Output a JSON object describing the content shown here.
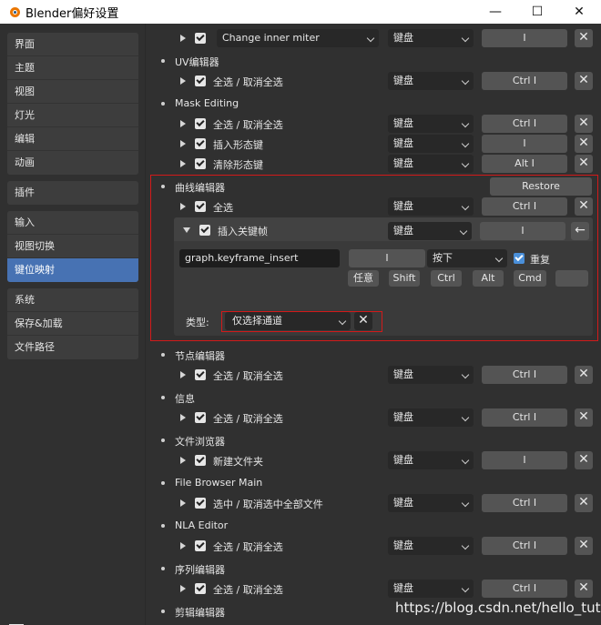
{
  "window": {
    "title": "Blender偏好设置",
    "minimize": "—",
    "maximize": "☐",
    "close": "✕"
  },
  "sidebar": {
    "group1": [
      "界面",
      "主题",
      "视图",
      "灯光",
      "编辑",
      "动画"
    ],
    "group2": [
      "插件"
    ],
    "group3": [
      "输入",
      "视图切换",
      "键位映射"
    ],
    "group4": [
      "系统",
      "保存&加载",
      "文件路径"
    ],
    "active": "键位映射"
  },
  "keymap": {
    "event_type": "键盘",
    "x": "✕",
    "sections": [
      {
        "name": "",
        "items": [
          {
            "label": "Change inner miter",
            "key": "I",
            "label_is_dropdown": true
          }
        ]
      },
      {
        "name": "UV编辑器",
        "items": [
          {
            "label": "全选 / 取消全选",
            "key": "Ctrl I"
          }
        ]
      },
      {
        "name": "Mask Editing",
        "items": [
          {
            "label": "全选 / 取消全选",
            "key": "Ctrl I"
          },
          {
            "label": "插入形态键",
            "key": "I"
          },
          {
            "label": "清除形态键",
            "key": "Alt I"
          }
        ]
      },
      {
        "name": "曲线编辑器",
        "restore": "Restore",
        "items": [
          {
            "label": "全选",
            "key": "Ctrl I"
          },
          {
            "label": "插入关键帧",
            "key": "I"
          }
        ]
      },
      {
        "name": "节点编辑器",
        "items": [
          {
            "label": "全选 / 取消全选",
            "key": "Ctrl I"
          }
        ]
      },
      {
        "name": "信息",
        "items": [
          {
            "label": "全选 / 取消全选",
            "key": "Ctrl I"
          }
        ]
      },
      {
        "name": "文件浏览器",
        "items": [
          {
            "label": "新建文件夹",
            "key": "I"
          }
        ]
      },
      {
        "name": "File Browser Main",
        "items": [
          {
            "label": "选中 / 取消选中全部文件",
            "key": "Ctrl I"
          }
        ]
      },
      {
        "name": "NLA Editor",
        "items": [
          {
            "label": "全选 / 取消全选",
            "key": "Ctrl I"
          }
        ]
      },
      {
        "name": "序列编辑器",
        "items": [
          {
            "label": "全选 / 取消全选",
            "key": "Ctrl I"
          }
        ]
      },
      {
        "name": "剪辑编辑器",
        "items": []
      }
    ],
    "expanded": {
      "operator": "graph.keyframe_insert",
      "key": "I",
      "value": "按下",
      "repeat_label": "重复",
      "modifiers": [
        "任意",
        "Shift",
        "Ctrl",
        "Alt",
        "Cmd"
      ],
      "key_modifier": "",
      "back_icon": "←",
      "type_label": "类型:",
      "type_value": "仅选择通道"
    }
  },
  "watermark": "https://blog.csdn.net/hello_tute"
}
